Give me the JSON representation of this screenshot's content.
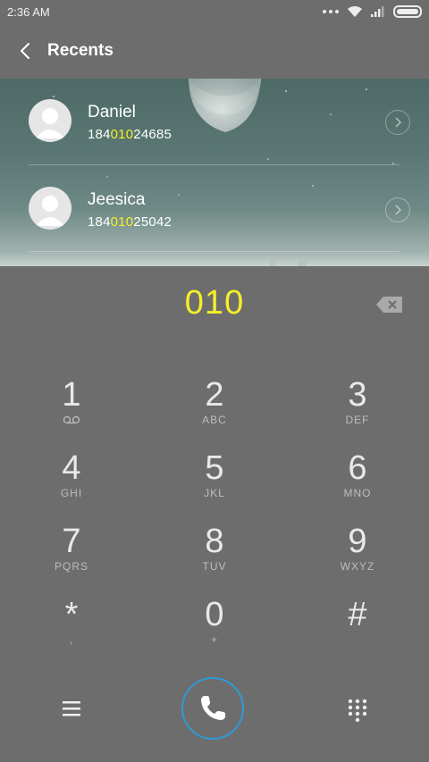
{
  "status_bar": {
    "time": "2:36 AM"
  },
  "header": {
    "title": "Recents"
  },
  "recents": [
    {
      "name": "Daniel",
      "number_prefix": "184",
      "number_match": "010",
      "number_suffix": "24685"
    },
    {
      "name": "Jeesica",
      "number_prefix": "184",
      "number_match": "010",
      "number_suffix": "25042"
    }
  ],
  "dialer": {
    "input": "010"
  },
  "keypad": [
    {
      "digit": "1",
      "letters": ""
    },
    {
      "digit": "2",
      "letters": "ABC"
    },
    {
      "digit": "3",
      "letters": "DEF"
    },
    {
      "digit": "4",
      "letters": "GHI"
    },
    {
      "digit": "5",
      "letters": "JKL"
    },
    {
      "digit": "6",
      "letters": "MNO"
    },
    {
      "digit": "7",
      "letters": "PQRS"
    },
    {
      "digit": "8",
      "letters": "TUV"
    },
    {
      "digit": "9",
      "letters": "WXYZ"
    },
    {
      "digit": "*",
      "letters": ","
    },
    {
      "digit": "0",
      "letters": "+"
    },
    {
      "digit": "#",
      "letters": ""
    }
  ],
  "colors": {
    "background": "#6d6d6d",
    "match_highlight": "#f5ef27",
    "call_ring": "#2f9ad6"
  },
  "icons": {
    "back": "chevron-left-icon",
    "backspace": "backspace-icon",
    "menu": "menu-icon",
    "call": "phone-icon",
    "dialpad": "dialpad-icon",
    "voicemail": "voicemail-icon"
  }
}
